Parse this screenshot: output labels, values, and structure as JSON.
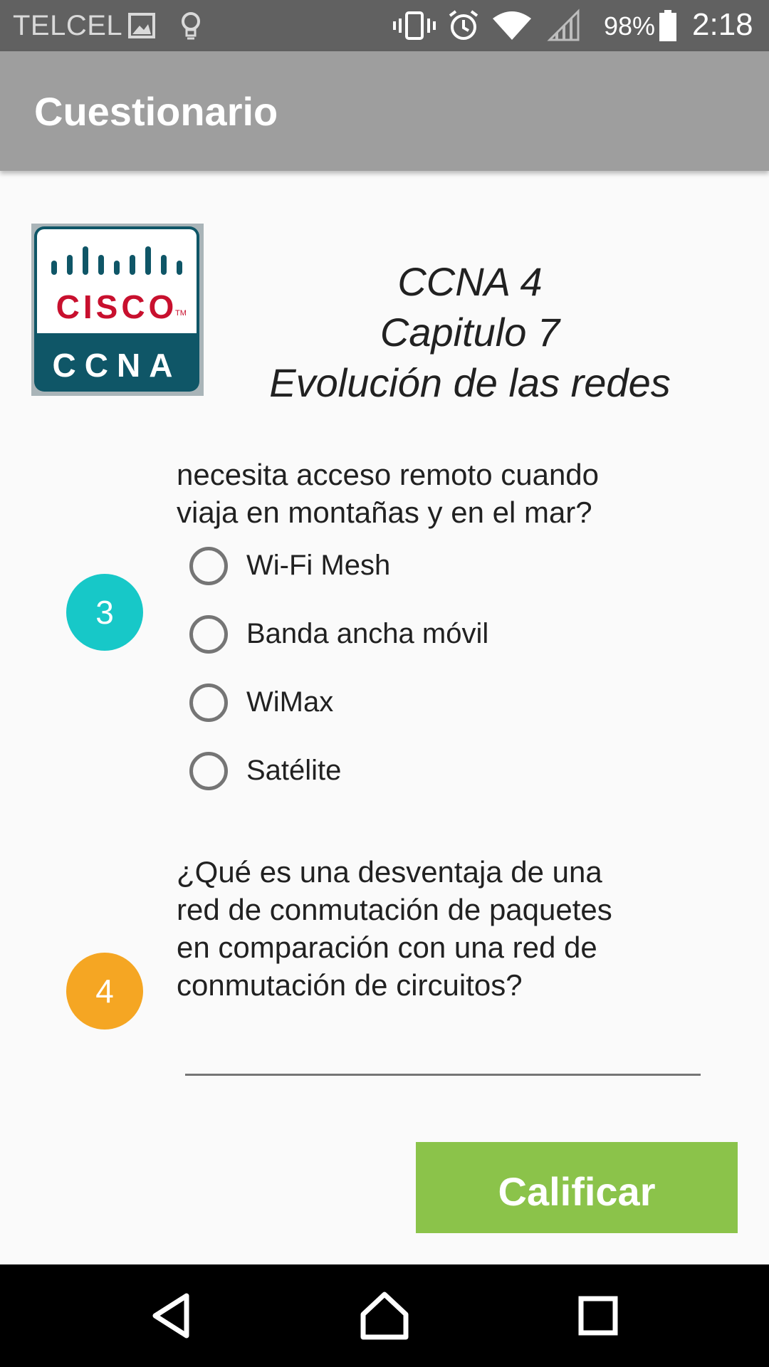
{
  "status_bar": {
    "carrier": "TELCEL",
    "battery": "98%",
    "time": "2:18",
    "icons": [
      "image-icon",
      "lightbulb-icon",
      "vibrate-icon",
      "alarm-icon",
      "wifi-icon",
      "signal-icon",
      "battery-icon"
    ]
  },
  "app_bar": {
    "title": "Cuestionario"
  },
  "header": {
    "logo": {
      "brand": "CISCO",
      "trademark": "TM",
      "product": "CCNA"
    },
    "line1": "CCNA 4",
    "line2": "Capitulo 7",
    "line3": "Evolución de las redes"
  },
  "questions": [
    {
      "number": "3",
      "color": "#17c8c8",
      "text_line1": "necesita acceso remoto cuando",
      "text_line2": "viaja en montañas y en el mar?",
      "options": [
        "Wi-Fi Mesh",
        "Banda ancha móvil",
        "WiMax",
        "Satélite"
      ]
    },
    {
      "number": "4",
      "color": "#f5a623",
      "text_line1": "¿Qué es una desventaja de una",
      "text_line2": "red de conmutación de paquetes",
      "text_line3": "en comparación con una red de",
      "text_line4": "conmutación de circuitos?",
      "answer_value": ""
    }
  ],
  "actions": {
    "grade_label": "Calificar"
  },
  "colors": {
    "status_bar": "#616161",
    "app_bar": "#9e9e9e",
    "grade_button": "#8bc34a"
  }
}
